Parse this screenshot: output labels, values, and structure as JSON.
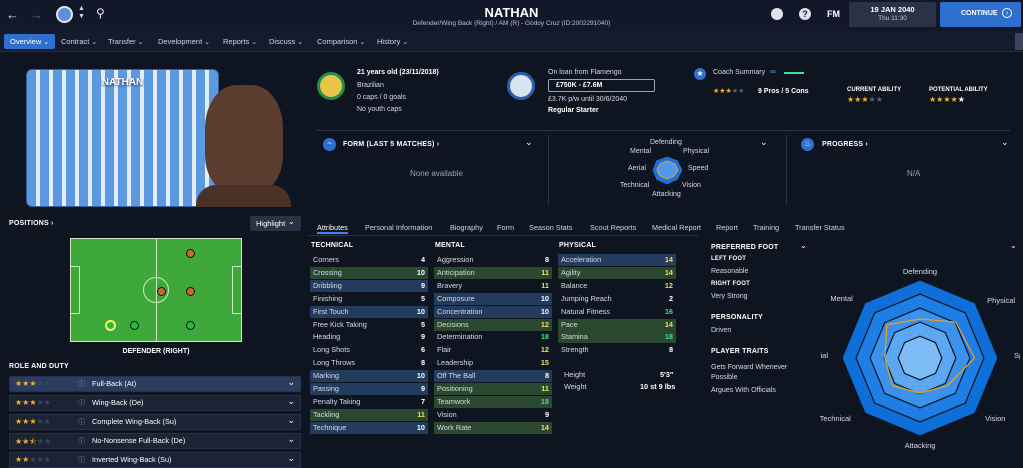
{
  "topbar": {
    "player_name": "NATHAN",
    "subtitle": "Defender/Wing Back (Right) / AM (R) - Godoy Cruz (ID:2002291040)",
    "date": "19 JAN 2040",
    "time": "Thu 11:30",
    "continue": "CONTINUE",
    "fm": "FM"
  },
  "nav": [
    "Overview",
    "Contract",
    "Transfer",
    "Development",
    "Reports",
    "Discuss",
    "Comparison",
    "History"
  ],
  "profile": {
    "card_name": "NATHAN",
    "age": "21 years old (23/11/2018)",
    "nationality": "Brazilian",
    "caps": "0 caps / 0 goals",
    "youth": "No youth caps",
    "loan": "On loan from Flamengo",
    "value": "£750K - £7.6M",
    "wage": "£3.7K p/w until 30/6/2040",
    "status": "Regular Starter"
  },
  "coach": {
    "title": "Coach Summary",
    "pros": "9 Pros / 5 Cons",
    "ca_label": "CURRENT ABILITY",
    "pa_label": "POTENTIAL ABILITY",
    "ca_stars": 3,
    "pa_stars": 4
  },
  "form": {
    "title": "FORM (LAST 5 MATCHES)",
    "empty": "None available"
  },
  "progress": {
    "title": "PROGRESS",
    "empty": "N/A"
  },
  "mini_radar": {
    "labels": [
      "Defending",
      "Physical",
      "Speed",
      "Vision",
      "Attacking",
      "Technical",
      "Aerial",
      "Mental"
    ]
  },
  "positions": {
    "title": "POSITIONS",
    "highlight": "Highlight",
    "caption": "DEFENDER (RIGHT)"
  },
  "roles": {
    "title": "ROLE AND DUTY",
    "items": [
      {
        "name": "Full-Back (At)",
        "stars": 3,
        "sel": true
      },
      {
        "name": "Wing-Back (De)",
        "stars": 3,
        "sel": false
      },
      {
        "name": "Complete Wing-Back (Su)",
        "stars": 3,
        "sel": false
      },
      {
        "name": "No-Nonsense Full-Back (De)",
        "stars": 2.5,
        "sel": false
      },
      {
        "name": "Inverted Wing-Back (Su)",
        "stars": 2,
        "sel": false
      }
    ]
  },
  "tabs": [
    "Attributes",
    "Personal Information",
    "Biography",
    "Form",
    "Season Stats",
    "Scout Reports",
    "Medical Report",
    "Report",
    "Training",
    "Transfer Status"
  ],
  "attributes": {
    "technical_title": "TECHNICAL",
    "mental_title": "MENTAL",
    "physical_title": "PHYSICAL",
    "technical": [
      [
        "Corners",
        "4",
        ""
      ],
      [
        "Crossing",
        "10",
        "g"
      ],
      [
        "Dribbling",
        "9",
        "b"
      ],
      [
        "Finishing",
        "5",
        ""
      ],
      [
        "First Touch",
        "10",
        "b"
      ],
      [
        "Free Kick Taking",
        "5",
        ""
      ],
      [
        "Heading",
        "9",
        ""
      ],
      [
        "Long Shots",
        "6",
        ""
      ],
      [
        "Long Throws",
        "8",
        ""
      ],
      [
        "Marking",
        "10",
        "b"
      ],
      [
        "Passing",
        "9",
        "b"
      ],
      [
        "Penalty Taking",
        "7",
        ""
      ],
      [
        "Tackling",
        "11",
        "g"
      ],
      [
        "Technique",
        "10",
        "b"
      ]
    ],
    "mental": [
      [
        "Aggression",
        "8",
        ""
      ],
      [
        "Anticipation",
        "11",
        "g"
      ],
      [
        "Bravery",
        "11",
        ""
      ],
      [
        "Composure",
        "10",
        "b"
      ],
      [
        "Concentration",
        "10",
        "b"
      ],
      [
        "Decisions",
        "12",
        "g"
      ],
      [
        "Determination",
        "18",
        ""
      ],
      [
        "Flair",
        "12",
        ""
      ],
      [
        "Leadership",
        "15",
        ""
      ],
      [
        "Off The Ball",
        "8",
        "b"
      ],
      [
        "Positioning",
        "11",
        "g"
      ],
      [
        "Teamwork",
        "18",
        "g"
      ],
      [
        "Vision",
        "9",
        ""
      ],
      [
        "Work Rate",
        "14",
        "g"
      ]
    ],
    "physical": [
      [
        "Acceleration",
        "14",
        "b"
      ],
      [
        "Agility",
        "14",
        "g"
      ],
      [
        "Balance",
        "12",
        ""
      ],
      [
        "Jumping Reach",
        "2",
        ""
      ],
      [
        "Natural Fitness",
        "16",
        ""
      ],
      [
        "Pace",
        "14",
        "g"
      ],
      [
        "Stamina",
        "18",
        "g"
      ],
      [
        "Strength",
        "8",
        ""
      ]
    ],
    "height_label": "Height",
    "height": "5'3\"",
    "weight_label": "Weight",
    "weight": "10 st 9 lbs"
  },
  "side": {
    "pref_foot": "PREFERRED FOOT",
    "left_foot": "LEFT FOOT",
    "left_val": "Reasonable",
    "right_foot": "RIGHT FOOT",
    "right_val": "Very Strong",
    "personality": "PERSONALITY",
    "personality_val": "Driven",
    "traits": "PLAYER TRAITS",
    "trait1": "Gets Forward Whenever Possible",
    "trait2": "Argues With Officials"
  },
  "radar": {
    "labels": [
      "Defending",
      "Physical",
      "Speed",
      "Vision",
      "Attacking",
      "Technical",
      "Aerial",
      "Mental"
    ],
    "values": [
      10,
      13,
      14,
      10,
      9,
      10,
      9,
      12
    ],
    "max": 20
  }
}
